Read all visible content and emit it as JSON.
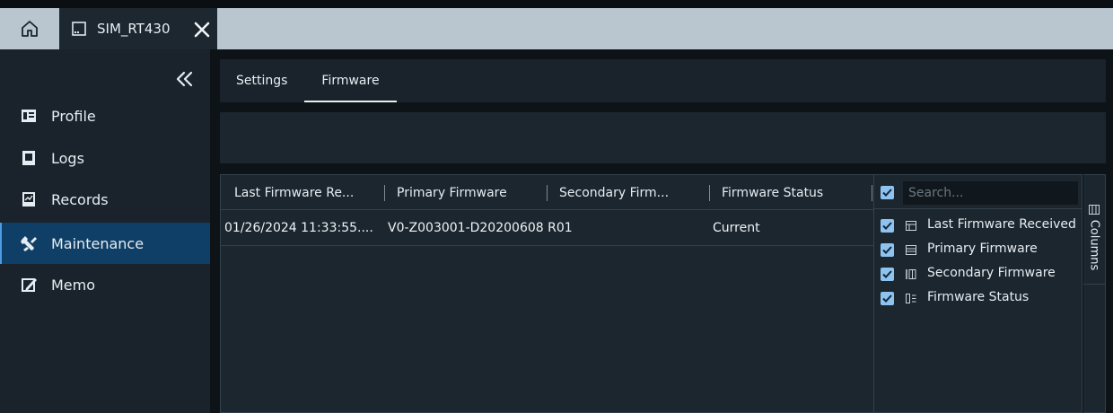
{
  "tabs": {
    "home_icon": "home-icon",
    "document": {
      "label": "SIM_RT430",
      "icon": "device-icon",
      "close_icon": "close-icon"
    }
  },
  "sidebar": {
    "collapse_icon": "double-chevron-left-icon",
    "items": [
      {
        "label": "Profile",
        "icon": "profile-icon",
        "active": false
      },
      {
        "label": "Logs",
        "icon": "logs-icon",
        "active": false
      },
      {
        "label": "Records",
        "icon": "records-icon",
        "active": false
      },
      {
        "label": "Maintenance",
        "icon": "wrench-icon",
        "active": true
      },
      {
        "label": "Memo",
        "icon": "memo-icon",
        "active": false
      }
    ]
  },
  "subtabs": [
    {
      "label": "Settings",
      "active": false
    },
    {
      "label": "Firmware",
      "active": true
    }
  ],
  "grid": {
    "columns": [
      "Last Firmware Re...",
      "Primary Firmware",
      "Secondary Firm...",
      "Firmware Status"
    ],
    "rows": [
      [
        "01/26/2024 11:33:55....",
        "V0-Z003001-D20200608 R01",
        "",
        "Current"
      ]
    ]
  },
  "columns_panel": {
    "search_placeholder": "Search...",
    "select_all_checked": true,
    "items": [
      {
        "label": "Last Firmware Received",
        "checked": true
      },
      {
        "label": "Primary Firmware",
        "checked": true
      },
      {
        "label": "Secondary Firmware",
        "checked": true
      },
      {
        "label": "Firmware Status",
        "checked": true
      }
    ],
    "side_label": "Columns"
  },
  "colors": {
    "accent": "#4d9be0",
    "active_nav": "#0f3f66",
    "checkbox": "#8ec3ef",
    "tabbar": "#b9c6cf"
  }
}
